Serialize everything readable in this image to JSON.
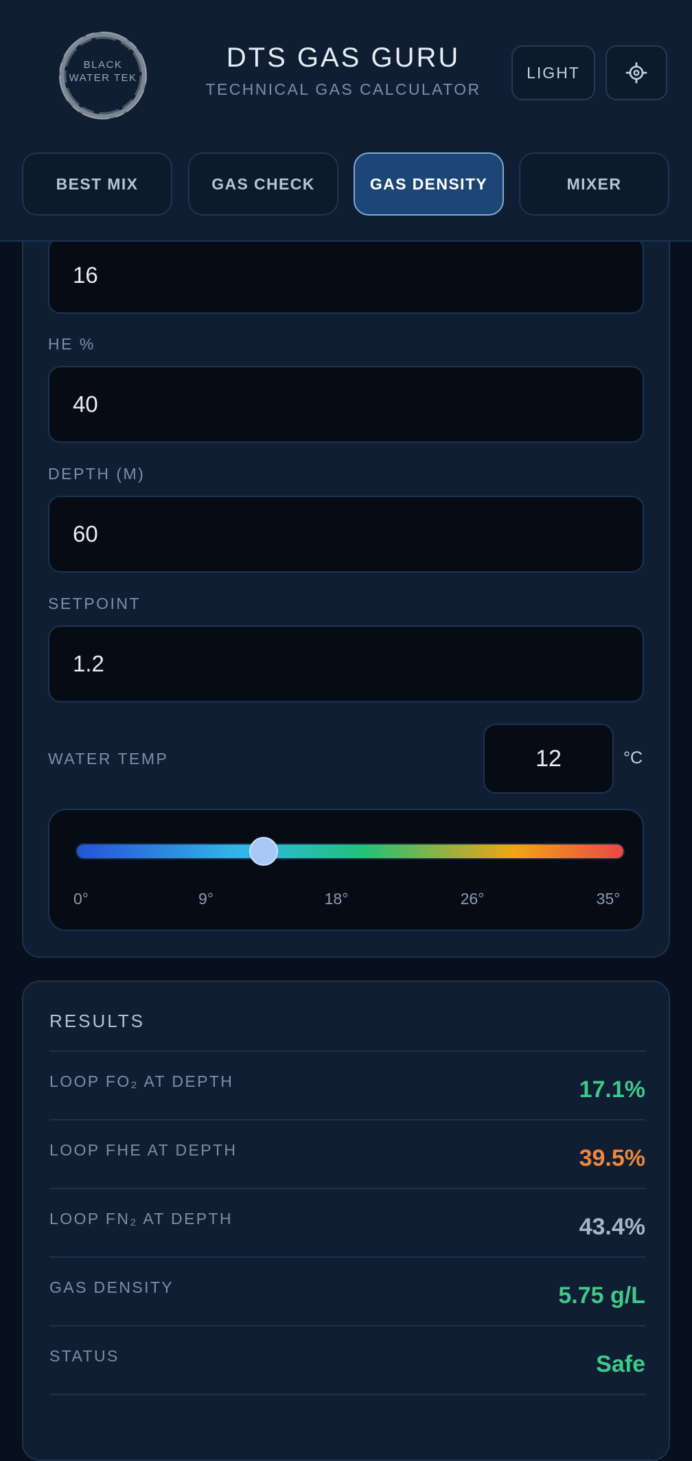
{
  "header": {
    "logo_line1": "BLACK",
    "logo_line2": "WATER TEK",
    "title": "DTS GAS GURU",
    "subtitle": "TECHNICAL GAS CALCULATOR",
    "light_label": "LIGHT",
    "gear_icon": "gear-icon"
  },
  "tabs": [
    {
      "label": "BEST MIX",
      "active": false
    },
    {
      "label": "GAS CHECK",
      "active": false
    },
    {
      "label": "GAS DENSITY",
      "active": true
    },
    {
      "label": "MIXER",
      "active": false
    }
  ],
  "form": {
    "o2_value": "16",
    "he_label": "HE %",
    "he_value": "40",
    "depth_label": "DEPTH (M)",
    "depth_value": "60",
    "setpoint_label": "SETPOINT",
    "setpoint_value": "1.2",
    "water_temp_label": "WATER TEMP",
    "water_temp_value": "12",
    "water_temp_unit": "°C",
    "slider": {
      "min": 0,
      "max": 35,
      "value": 12,
      "ticks": [
        "0°",
        "9°",
        "18°",
        "26°",
        "35°"
      ]
    }
  },
  "results": {
    "title": "RESULTS",
    "rows": [
      {
        "label": "LOOP FO₂ AT DEPTH",
        "value": "17.1%",
        "color": "#3fc98a"
      },
      {
        "label": "LOOP FHE AT DEPTH",
        "value": "39.5%",
        "color": "#f0873a"
      },
      {
        "label": "LOOP FN₂ AT DEPTH",
        "value": "43.4%",
        "color": "#a9b6c5"
      },
      {
        "label": "GAS DENSITY",
        "value": "5.75 g/L",
        "color": "#3fc98a"
      },
      {
        "label": "STATUS",
        "value": "Safe",
        "color": "#3fc98a"
      }
    ]
  }
}
